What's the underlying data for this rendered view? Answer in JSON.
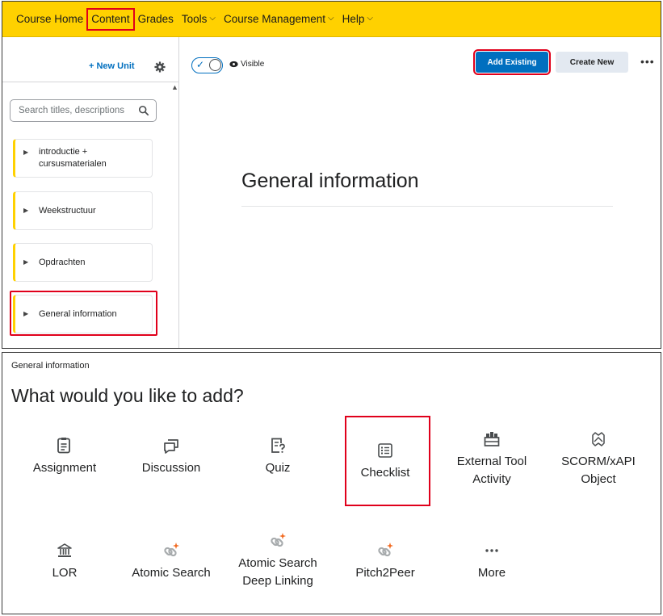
{
  "navbar": {
    "items": [
      "Course Home",
      "Content",
      "Grades",
      "Tools",
      "Course Management",
      "Help"
    ]
  },
  "sidebar": {
    "new_unit_label": "+ New Unit",
    "search_placeholder": "Search titles, descriptions",
    "units": [
      {
        "label_line1": "introductie +",
        "label_line2": "cursusmaterialen"
      },
      {
        "label_line1": "Weekstructuur"
      },
      {
        "label_line1": "Opdrachten"
      },
      {
        "label_line1": "General information"
      }
    ]
  },
  "toolbar": {
    "visible_label": "Visible",
    "add_existing_label": "Add Existing",
    "create_new_label": "Create New",
    "more_label": "•••"
  },
  "main": {
    "unit_title": "General information"
  },
  "dialog": {
    "breadcrumb": "General information",
    "title": "What would you like to add?",
    "tiles": [
      {
        "line1": "Assignment",
        "icon": "assignment-icon"
      },
      {
        "line1": "Discussion",
        "icon": "discussion-icon"
      },
      {
        "line1": "Quiz",
        "icon": "quiz-icon"
      },
      {
        "line1": "Checklist",
        "icon": "checklist-icon"
      },
      {
        "line1": "External Tool",
        "line2": "Activity",
        "icon": "external-tool-icon"
      },
      {
        "line1": "SCORM/xAPI",
        "line2": "Object",
        "icon": "scorm-icon"
      },
      {
        "line1": "LOR",
        "icon": "lor-icon"
      },
      {
        "line1": "Atomic Search",
        "icon": "atomic-search-icon"
      },
      {
        "line1": "Atomic Search",
        "line2": "Deep Linking",
        "icon": "atomic-search-deep-linking-icon"
      },
      {
        "line1": "Pitch2Peer",
        "icon": "pitch2peer-icon"
      },
      {
        "line1": "More",
        "icon": "more-icon"
      }
    ]
  },
  "colors": {
    "navbar_bg": "#ffd100",
    "primary": "#006fbf",
    "highlight": "#e0001b"
  }
}
